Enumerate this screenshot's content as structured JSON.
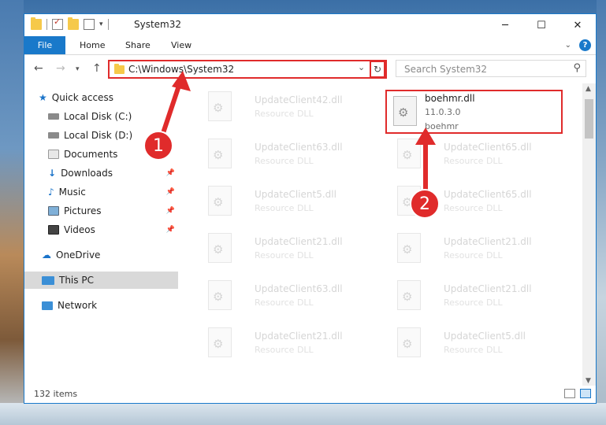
{
  "window": {
    "title": "System32"
  },
  "ribbon": {
    "tabs": [
      "File",
      "Home",
      "Share",
      "View"
    ]
  },
  "address": {
    "path": "C:\\Windows\\System32"
  },
  "search": {
    "placeholder": "Search System32"
  },
  "sidebar": {
    "items": [
      {
        "label": "Quick access",
        "icon": "star-icon",
        "color": "#1a73c9"
      },
      {
        "label": "Local Disk (C:)",
        "icon": "drive-icon",
        "color": "#6a6a6a"
      },
      {
        "label": "Local Disk (D:)",
        "icon": "drive-icon",
        "color": "#6a6a6a"
      },
      {
        "label": "Documents",
        "icon": "documents-icon",
        "color": "#9a9a9a"
      },
      {
        "label": "Downloads",
        "icon": "download-icon",
        "color": "#1a73c9"
      },
      {
        "label": "Music",
        "icon": "music-icon",
        "color": "#1a73c9"
      },
      {
        "label": "Pictures",
        "icon": "pictures-icon",
        "color": "#4a90c8"
      },
      {
        "label": "Videos",
        "icon": "videos-icon",
        "color": "#555555"
      },
      {
        "label": "OneDrive",
        "icon": "onedrive-icon",
        "color": "#1a73c9"
      },
      {
        "label": "This PC",
        "icon": "computer-icon",
        "color": "#3b8fd6"
      },
      {
        "label": "Network",
        "icon": "network-icon",
        "color": "#3b8fd6"
      }
    ]
  },
  "files": [
    {
      "name": "UpdateClient42.dll",
      "desc": "Resource DLL"
    },
    {
      "name": "boehmr.dll",
      "version": "11.0.3.0",
      "desc": "boehmr"
    },
    {
      "name": "UpdateClient63.dll",
      "desc": "Resource DLL"
    },
    {
      "name": "UpdateClient65.dll",
      "desc": "Resource DLL"
    },
    {
      "name": "UpdateClient5.dll",
      "desc": "Resource DLL"
    },
    {
      "name": "UpdateClient65.dll",
      "desc": "Resource DLL"
    },
    {
      "name": "UpdateClient21.dll",
      "desc": "Resource DLL"
    },
    {
      "name": "UpdateClient21.dll",
      "desc": "Resource DLL"
    },
    {
      "name": "UpdateClient63.dll",
      "desc": "Resource DLL"
    },
    {
      "name": "UpdateClient21.dll",
      "desc": "Resource DLL"
    },
    {
      "name": "UpdateClient21.dll",
      "desc": "Resource DLL"
    },
    {
      "name": "UpdateClient5.dll",
      "desc": "Resource DLL"
    }
  ],
  "status": {
    "count": "132 items"
  },
  "annotations": {
    "step1": "1",
    "step2": "2",
    "color": "#e02b2b"
  }
}
